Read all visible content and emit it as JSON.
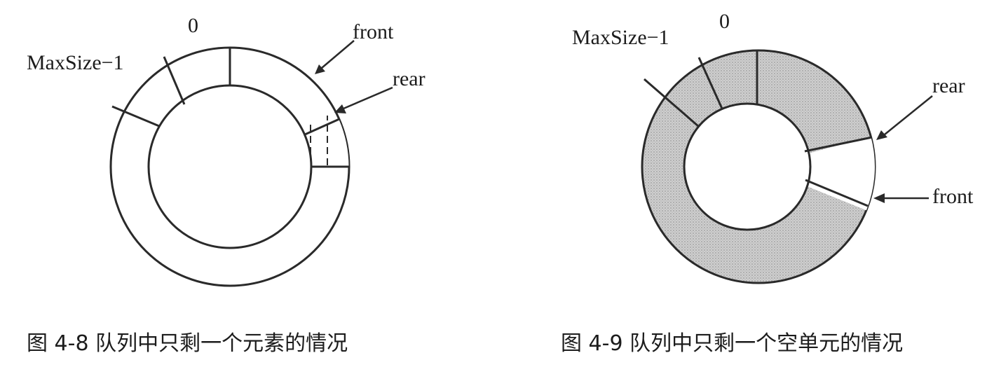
{
  "figures": [
    {
      "id": "4-8",
      "caption": "图 4-8   队列中只剩一个元素的情况",
      "labels": {
        "zero": "0",
        "max": "MaxSize−1",
        "front": "front",
        "rear": "rear"
      },
      "state": "one-element-occupied",
      "fill_color": "#ffffff"
    },
    {
      "id": "4-9",
      "caption": "图 4-9   队列中只剩一个空单元的情况",
      "labels": {
        "zero": "0",
        "max": "MaxSize−1",
        "front": "front",
        "rear": "rear"
      },
      "state": "one-empty-cell",
      "fill_color": "#c8c8c8"
    }
  ]
}
